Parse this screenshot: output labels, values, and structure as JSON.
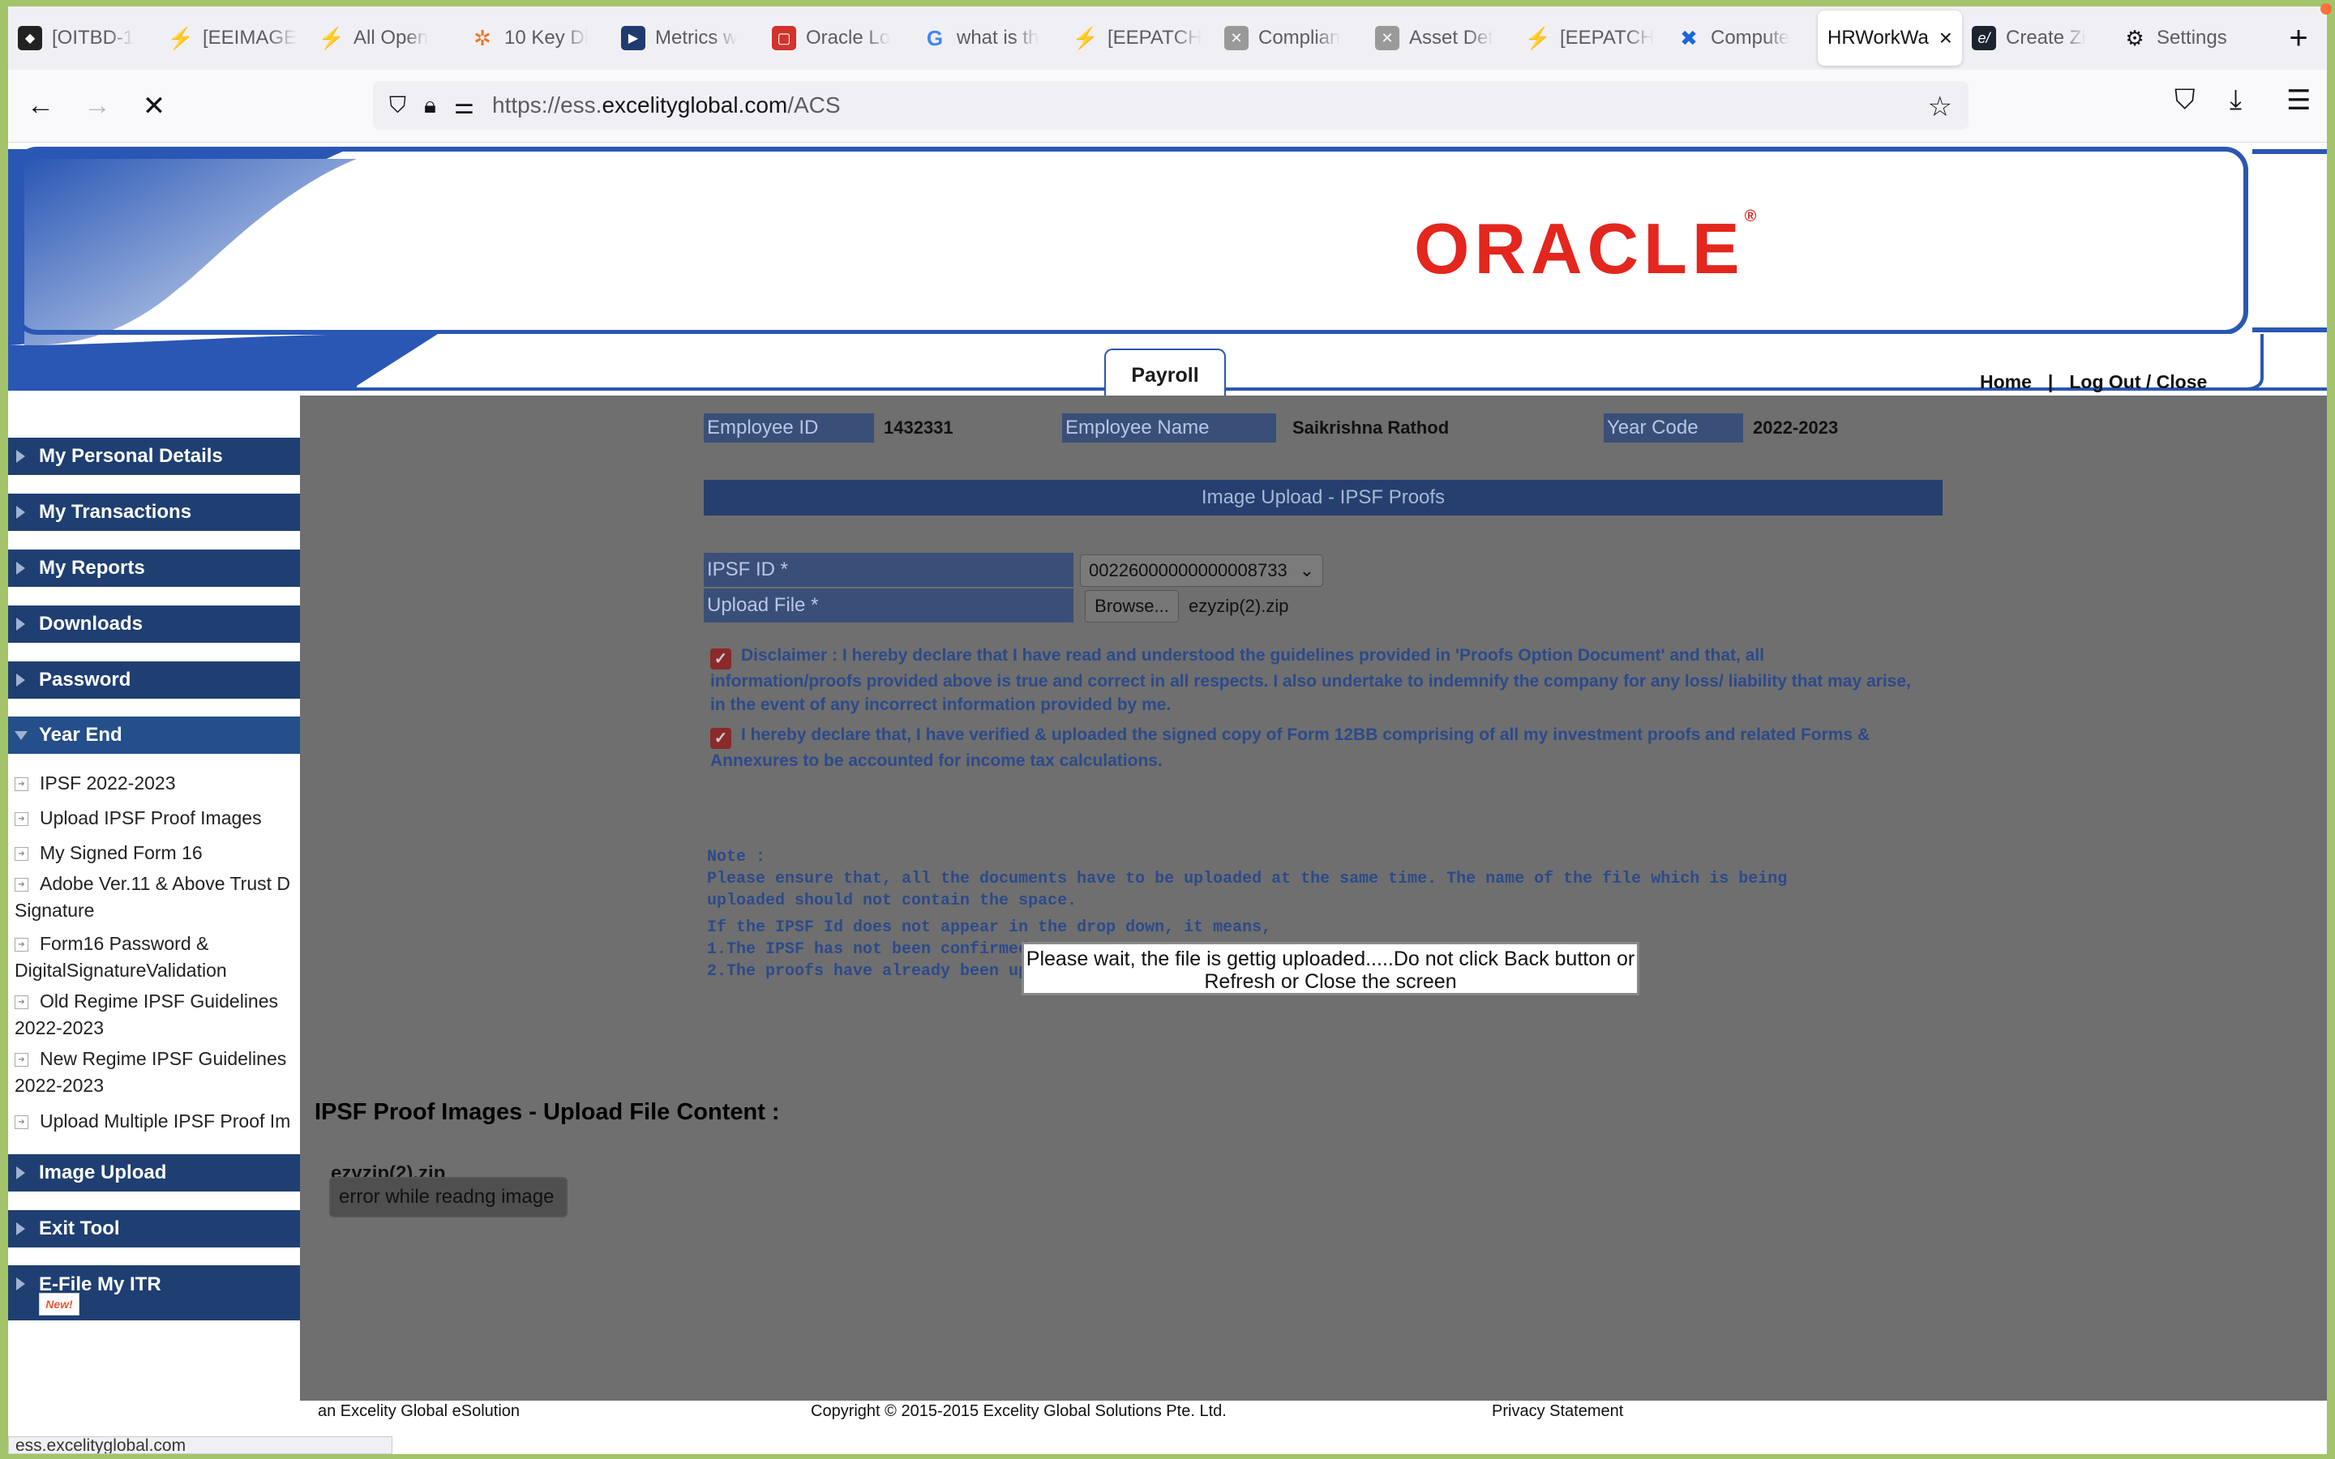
{
  "browser": {
    "tabs": [
      {
        "label": "[OITBD-1",
        "icon": "jira-icon"
      },
      {
        "label": "[EEIMAGE",
        "icon": "bolt-icon"
      },
      {
        "label": "All Open",
        "icon": "bolt-icon"
      },
      {
        "label": "10 Key Di",
        "icon": "gear-orange-icon"
      },
      {
        "label": "Metrics w",
        "icon": "video-icon"
      },
      {
        "label": "Oracle Lo",
        "icon": "oracle-icon"
      },
      {
        "label": "what is th",
        "icon": "google-icon"
      },
      {
        "label": "[EEPATCH",
        "icon": "bolt-icon"
      },
      {
        "label": "Complian",
        "icon": "grid-icon"
      },
      {
        "label": "Asset Det",
        "icon": "grid-icon"
      },
      {
        "label": "[EEPATCH",
        "icon": "bolt-icon"
      },
      {
        "label": "Compute",
        "icon": "confluence-icon"
      },
      {
        "label": "HRWorkWa",
        "icon": "",
        "active": true
      },
      {
        "label": "Create Zi",
        "icon": "e-icon"
      },
      {
        "label": "Settings",
        "icon": "gear-icon"
      }
    ],
    "url_prefix": "https://ess.",
    "url_host": "excelityglobal.com",
    "url_path": "/ACS",
    "status_url": "ess.excelityglobal.com"
  },
  "banner": {
    "logo": "ORACLE",
    "logo_mark": "®",
    "tab": "Payroll",
    "home": "Home",
    "sep": "|",
    "logout": "Log Out / Close"
  },
  "sidebar": {
    "menus": [
      {
        "label": "My Personal Details"
      },
      {
        "label": "My Transactions"
      },
      {
        "label": "My Reports"
      },
      {
        "label": "Downloads"
      },
      {
        "label": "Password"
      },
      {
        "label": "Year End"
      }
    ],
    "year_end_items": [
      {
        "label": "IPSF 2022-2023"
      },
      {
        "label": "Upload IPSF Proof Images"
      },
      {
        "label": "My Signed Form 16"
      },
      {
        "label": "Adobe Ver.11 & Above Trust D",
        "label2": "Signature"
      },
      {
        "label": "Form16 Password &",
        "label2": "DigitalSignatureValidation"
      },
      {
        "label": "Old Regime IPSF Guidelines",
        "label2": "2022-2023"
      },
      {
        "label": "New Regime IPSF Guidelines",
        "label2": "2022-2023"
      },
      {
        "label": "Upload Multiple IPSF Proof Im"
      }
    ],
    "bottom_menus": [
      {
        "label": "Image Upload"
      },
      {
        "label": "Exit Tool"
      },
      {
        "label": "E-File My ITR"
      }
    ],
    "new_badge": "New!"
  },
  "form": {
    "employee_id_label": "Employee ID",
    "employee_id": "1432331",
    "employee_name_label": "Employee Name",
    "employee_name": "Saikrishna Rathod",
    "year_code_label": "Year Code",
    "year_code": "2022-2023",
    "title": "Image Upload - IPSF Proofs",
    "ipsf_label": "IPSF ID *",
    "ipsf_value": "00226000000000008733",
    "upload_label": "Upload File *",
    "browse": "Browse...",
    "file_name": "ezyzip(2).zip",
    "disclaimer1_l1": "Disclaimer : I hereby declare that I have read and understood the guidelines provided in 'Proofs Option Document' and that, all",
    "disclaimer1_l2": "information/proofs provided above is true and correct in all respects. I also undertake to indemnify the company for any loss/ liability that may arise,",
    "disclaimer1_l3": "in the event of any incorrect information provided by me.",
    "disclaimer2_l1": "I hereby declare that, I have verified & uploaded the signed copy of Form 12BB comprising of all my investment proofs and related Forms &",
    "disclaimer2_l2": "Annexures to be accounted for income tax calculations.",
    "note_title": "Note :",
    "note_l1": "Please ensure that, all the documents have to be uploaded at the same time. The name of the file which is being",
    "note_l2": "uploaded should not contain the space.",
    "note_l3": "If the IPSF Id does not appear in the drop down, it means,",
    "note_l4": "1.The IPSF has not been confirmed, OR",
    "note_l5": "2.The proofs have already been uploaded."
  },
  "modal": {
    "line1": "Please wait, the file is gettig uploaded.....Do not click Back button or",
    "line2": "Refresh or Close the screen"
  },
  "upload_content": {
    "title": "IPSF Proof Images - Upload File Content :",
    "zip_name": "ezyzip(2).zip",
    "error": "error while readng image"
  },
  "footer": {
    "left": "an Excelity Global eSolution",
    "center": "Copyright © 2015-2015 Excelity Global Solutions Pte. Ltd.",
    "right": "Privacy Statement"
  }
}
